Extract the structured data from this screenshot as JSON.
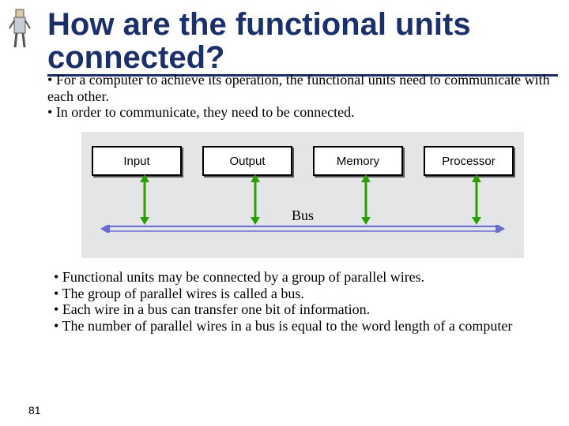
{
  "title": "How are the functional units connected?",
  "intro_bullets": [
    "For a computer to achieve its operation, the functional units need to communicate with each other.",
    "In order to communicate, they need to be connected."
  ],
  "diagram": {
    "units": [
      "Input",
      "Output",
      "Memory",
      "Processor"
    ],
    "bus_label": "Bus"
  },
  "outro_bullets": [
    "Functional units may be connected by a group of parallel wires.",
    "The group of parallel wires is called a bus.",
    "Each wire in a bus can transfer one bit of information.",
    "The number of parallel wires in a bus is equal to the word length of a computer"
  ],
  "page_number": "81",
  "colors": {
    "title": "#1b2f6b",
    "diagram_bg": "#e3e5e7"
  },
  "decoration_icon": "robot-figure-icon"
}
